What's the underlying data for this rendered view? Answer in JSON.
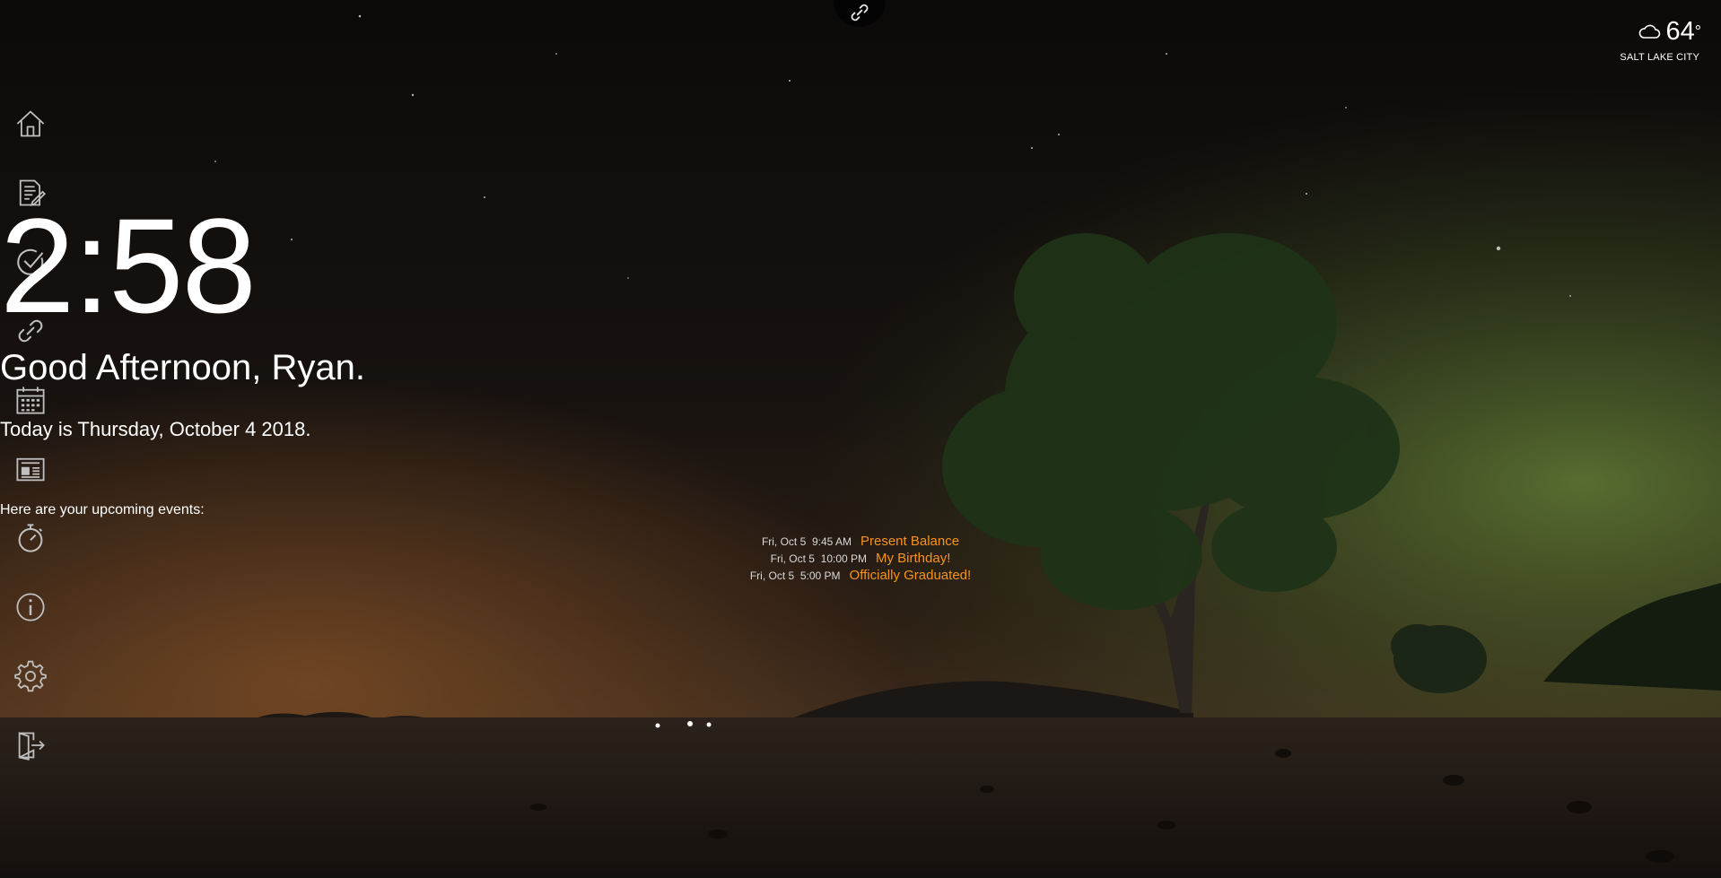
{
  "app": {
    "name": "Dashboard new tab"
  },
  "colors": {
    "accent": "#f7931e",
    "text": "#ffffff",
    "icon": "#bfbfbf"
  },
  "top_tab": {
    "icon": "link-icon"
  },
  "sidebar": {
    "items": [
      {
        "name": "home",
        "icon": "home-icon"
      },
      {
        "name": "notes",
        "icon": "notes-icon"
      },
      {
        "name": "todo",
        "icon": "checkmark-icon"
      },
      {
        "name": "links",
        "icon": "link-icon"
      },
      {
        "name": "calendar",
        "icon": "calendar-icon"
      },
      {
        "name": "news",
        "icon": "newspaper-icon"
      },
      {
        "name": "timer",
        "icon": "stopwatch-icon"
      },
      {
        "name": "info",
        "icon": "info-icon"
      },
      {
        "name": "settings",
        "icon": "gear-icon"
      },
      {
        "name": "logout",
        "icon": "exit-door-icon"
      }
    ]
  },
  "weather": {
    "icon": "cloud-icon",
    "temperature": "64",
    "degree": "°",
    "city": "SALT LAKE CITY"
  },
  "clock": {
    "time": "2:58"
  },
  "greeting": "Good Afternoon, Ryan.",
  "today": "Today is Thursday, October 4 2018.",
  "events": {
    "heading": "Here are your upcoming events:",
    "items": [
      {
        "date": "Fri, Oct 5",
        "time": "9:45 AM",
        "title": "Present Balance"
      },
      {
        "date": "Fri, Oct 5",
        "time": "10:00 PM",
        "title": "My Birthday!"
      },
      {
        "date": "Fri, Oct 5",
        "time": "5:00 PM",
        "title": "Officially Graduated!"
      }
    ]
  }
}
